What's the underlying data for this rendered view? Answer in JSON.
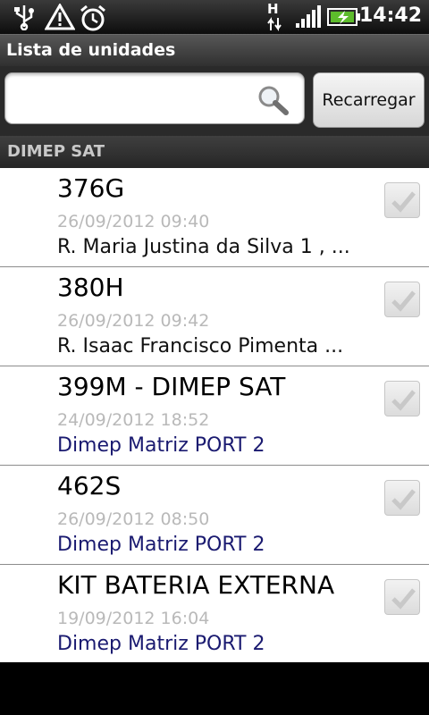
{
  "status_bar": {
    "time": "14:42",
    "network_type": "H",
    "icons": [
      "usb-icon",
      "warning-icon",
      "alarm-icon",
      "network-arrows-icon",
      "signal-icon",
      "battery-charging-icon"
    ]
  },
  "app": {
    "title": "Lista de unidades"
  },
  "search": {
    "value": "",
    "placeholder": "",
    "reload_label": "Recarregar"
  },
  "section": {
    "label": "DIMEP SAT"
  },
  "items": [
    {
      "title": "376G",
      "date": "26/09/2012 09:40",
      "subtitle": "R. Maria Justina da Silva 1 , ...",
      "checked": true
    },
    {
      "title": "380H",
      "date": "26/09/2012 09:42",
      "subtitle": "R. Isaac Francisco Pimenta ...",
      "checked": true
    },
    {
      "title": "399M - DIMEP SAT",
      "date": "24/09/2012 18:52",
      "subtitle": "Dimep Matriz PORT 2",
      "checked": true
    },
    {
      "title": "462S",
      "date": "26/09/2012 08:50",
      "subtitle": "Dimep Matriz PORT 2",
      "checked": true
    },
    {
      "title": "KIT BATERIA EXTERNA",
      "date": "19/09/2012 16:04",
      "subtitle": "Dimep Matriz PORT 2",
      "checked": true
    }
  ],
  "colors": {
    "address_text": "#111111",
    "port_text": "#1a1a70",
    "date_text": "#b9b9b9"
  }
}
